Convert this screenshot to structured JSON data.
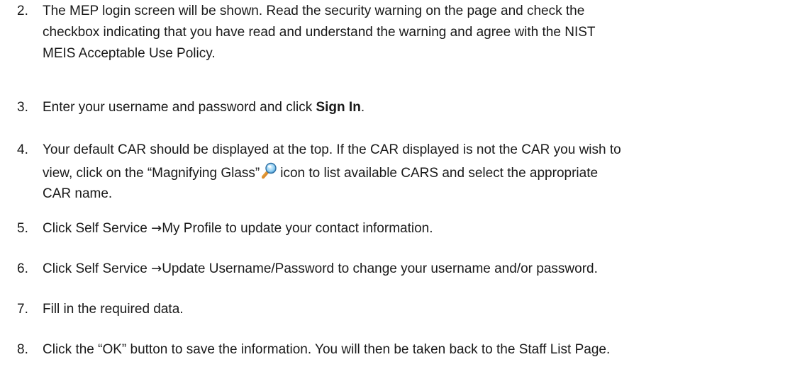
{
  "steps": [
    {
      "num": "2.",
      "lines": [
        "The MEP login screen will be shown. Read the security warning on the page and check the",
        "checkbox indicating that you have read and understand the warning and agree with the NIST",
        "MEIS Acceptable Use Policy."
      ]
    },
    {
      "num": "3.",
      "pre": "Enter your username and password and click ",
      "bold": "Sign In",
      "post": "."
    },
    {
      "num": "4.",
      "line1": "Your default CAR should be displayed at the top. If the CAR displayed is not the CAR you wish to",
      "line2_pre": "view, click on the “Magnifying Glass”",
      "icon": "magnifying-glass-icon",
      "line2_post": "icon to list available CARS and select the appropriate",
      "line3": "CAR name."
    },
    {
      "num": "5.",
      "pre": "Click Self Service ",
      "arrow": "→",
      "post": "My Profile to update your contact information."
    },
    {
      "num": "6.",
      "pre": "Click Self Service ",
      "arrow": "→",
      "post": "Update Username/Password to change your username and/or password."
    },
    {
      "num": "7.",
      "text": "Fill in the required data."
    },
    {
      "num": "8.",
      "text": "Click the “OK” button to save the information. You will then be taken back to the Staff List Page."
    }
  ]
}
